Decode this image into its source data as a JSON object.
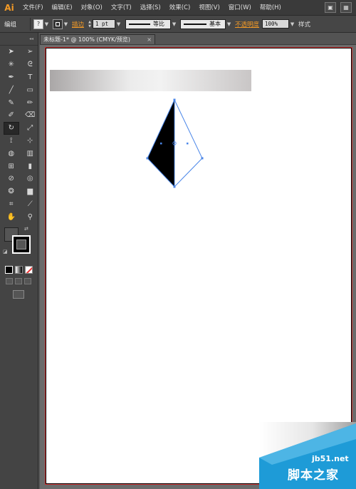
{
  "app": {
    "logo": "Ai"
  },
  "menu": [
    "文件(F)",
    "编辑(E)",
    "对象(O)",
    "文字(T)",
    "选择(S)",
    "效果(C)",
    "视图(V)",
    "窗口(W)",
    "帮助(H)"
  ],
  "control_bar": {
    "mode": "编组",
    "fill_glyph": "?",
    "stroke_label": "描边",
    "stroke_weight": "1 pt",
    "profile_label": "等比",
    "brush_label": "基本",
    "opacity_label": "不透明度",
    "opacity_value": "100%",
    "style_label": "样式"
  },
  "document": {
    "tab_title": "未标题-1* @ 100% (CMYK/预览)",
    "close_glyph": "×"
  },
  "toolbar": {
    "tools": [
      [
        "selection-tool",
        "direct-selection-tool"
      ],
      [
        "magic-wand-tool",
        "lasso-tool"
      ],
      [
        "pen-tool",
        "type-tool"
      ],
      [
        "line-segment-tool",
        "rectangle-tool"
      ],
      [
        "paintbrush-tool",
        "pencil-tool"
      ],
      [
        "blob-brush-tool",
        "eraser-tool"
      ],
      [
        "rotate-tool",
        "scale-tool"
      ],
      [
        "width-tool",
        "free-transform-tool"
      ],
      [
        "shape-builder-tool",
        "perspective-grid-tool"
      ],
      [
        "mesh-tool",
        "gradient-tool"
      ],
      [
        "eyedropper-tool",
        "blend-tool"
      ],
      [
        "symbol-sprayer-tool",
        "column-graph-tool"
      ],
      [
        "artboard-tool",
        "slice-tool"
      ],
      [
        "hand-tool",
        "zoom-tool"
      ]
    ],
    "glyphs": [
      [
        "➤",
        "➢"
      ],
      [
        "✳",
        "ᘓ"
      ],
      [
        "✒",
        "T"
      ],
      [
        "╱",
        "▭"
      ],
      [
        "✎",
        "✏"
      ],
      [
        "✐",
        "⌫"
      ],
      [
        "↻",
        "⤢"
      ],
      [
        "⟟",
        "⊹"
      ],
      [
        "◍",
        "▥"
      ],
      [
        "⊞",
        "▮"
      ],
      [
        "⊘",
        "◎"
      ],
      [
        "❂",
        "▆"
      ],
      [
        "⌗",
        "⟋"
      ],
      [
        "✋",
        "⚲"
      ]
    ],
    "active_tool": "rotate-tool"
  },
  "colors": {
    "accent": "#f39a26",
    "artboard_border": "#c83232",
    "selection": "#4a86e8",
    "ui_dark": "#444444"
  },
  "watermark": {
    "site": "jb51.net",
    "name_cn": "脚本之家"
  }
}
